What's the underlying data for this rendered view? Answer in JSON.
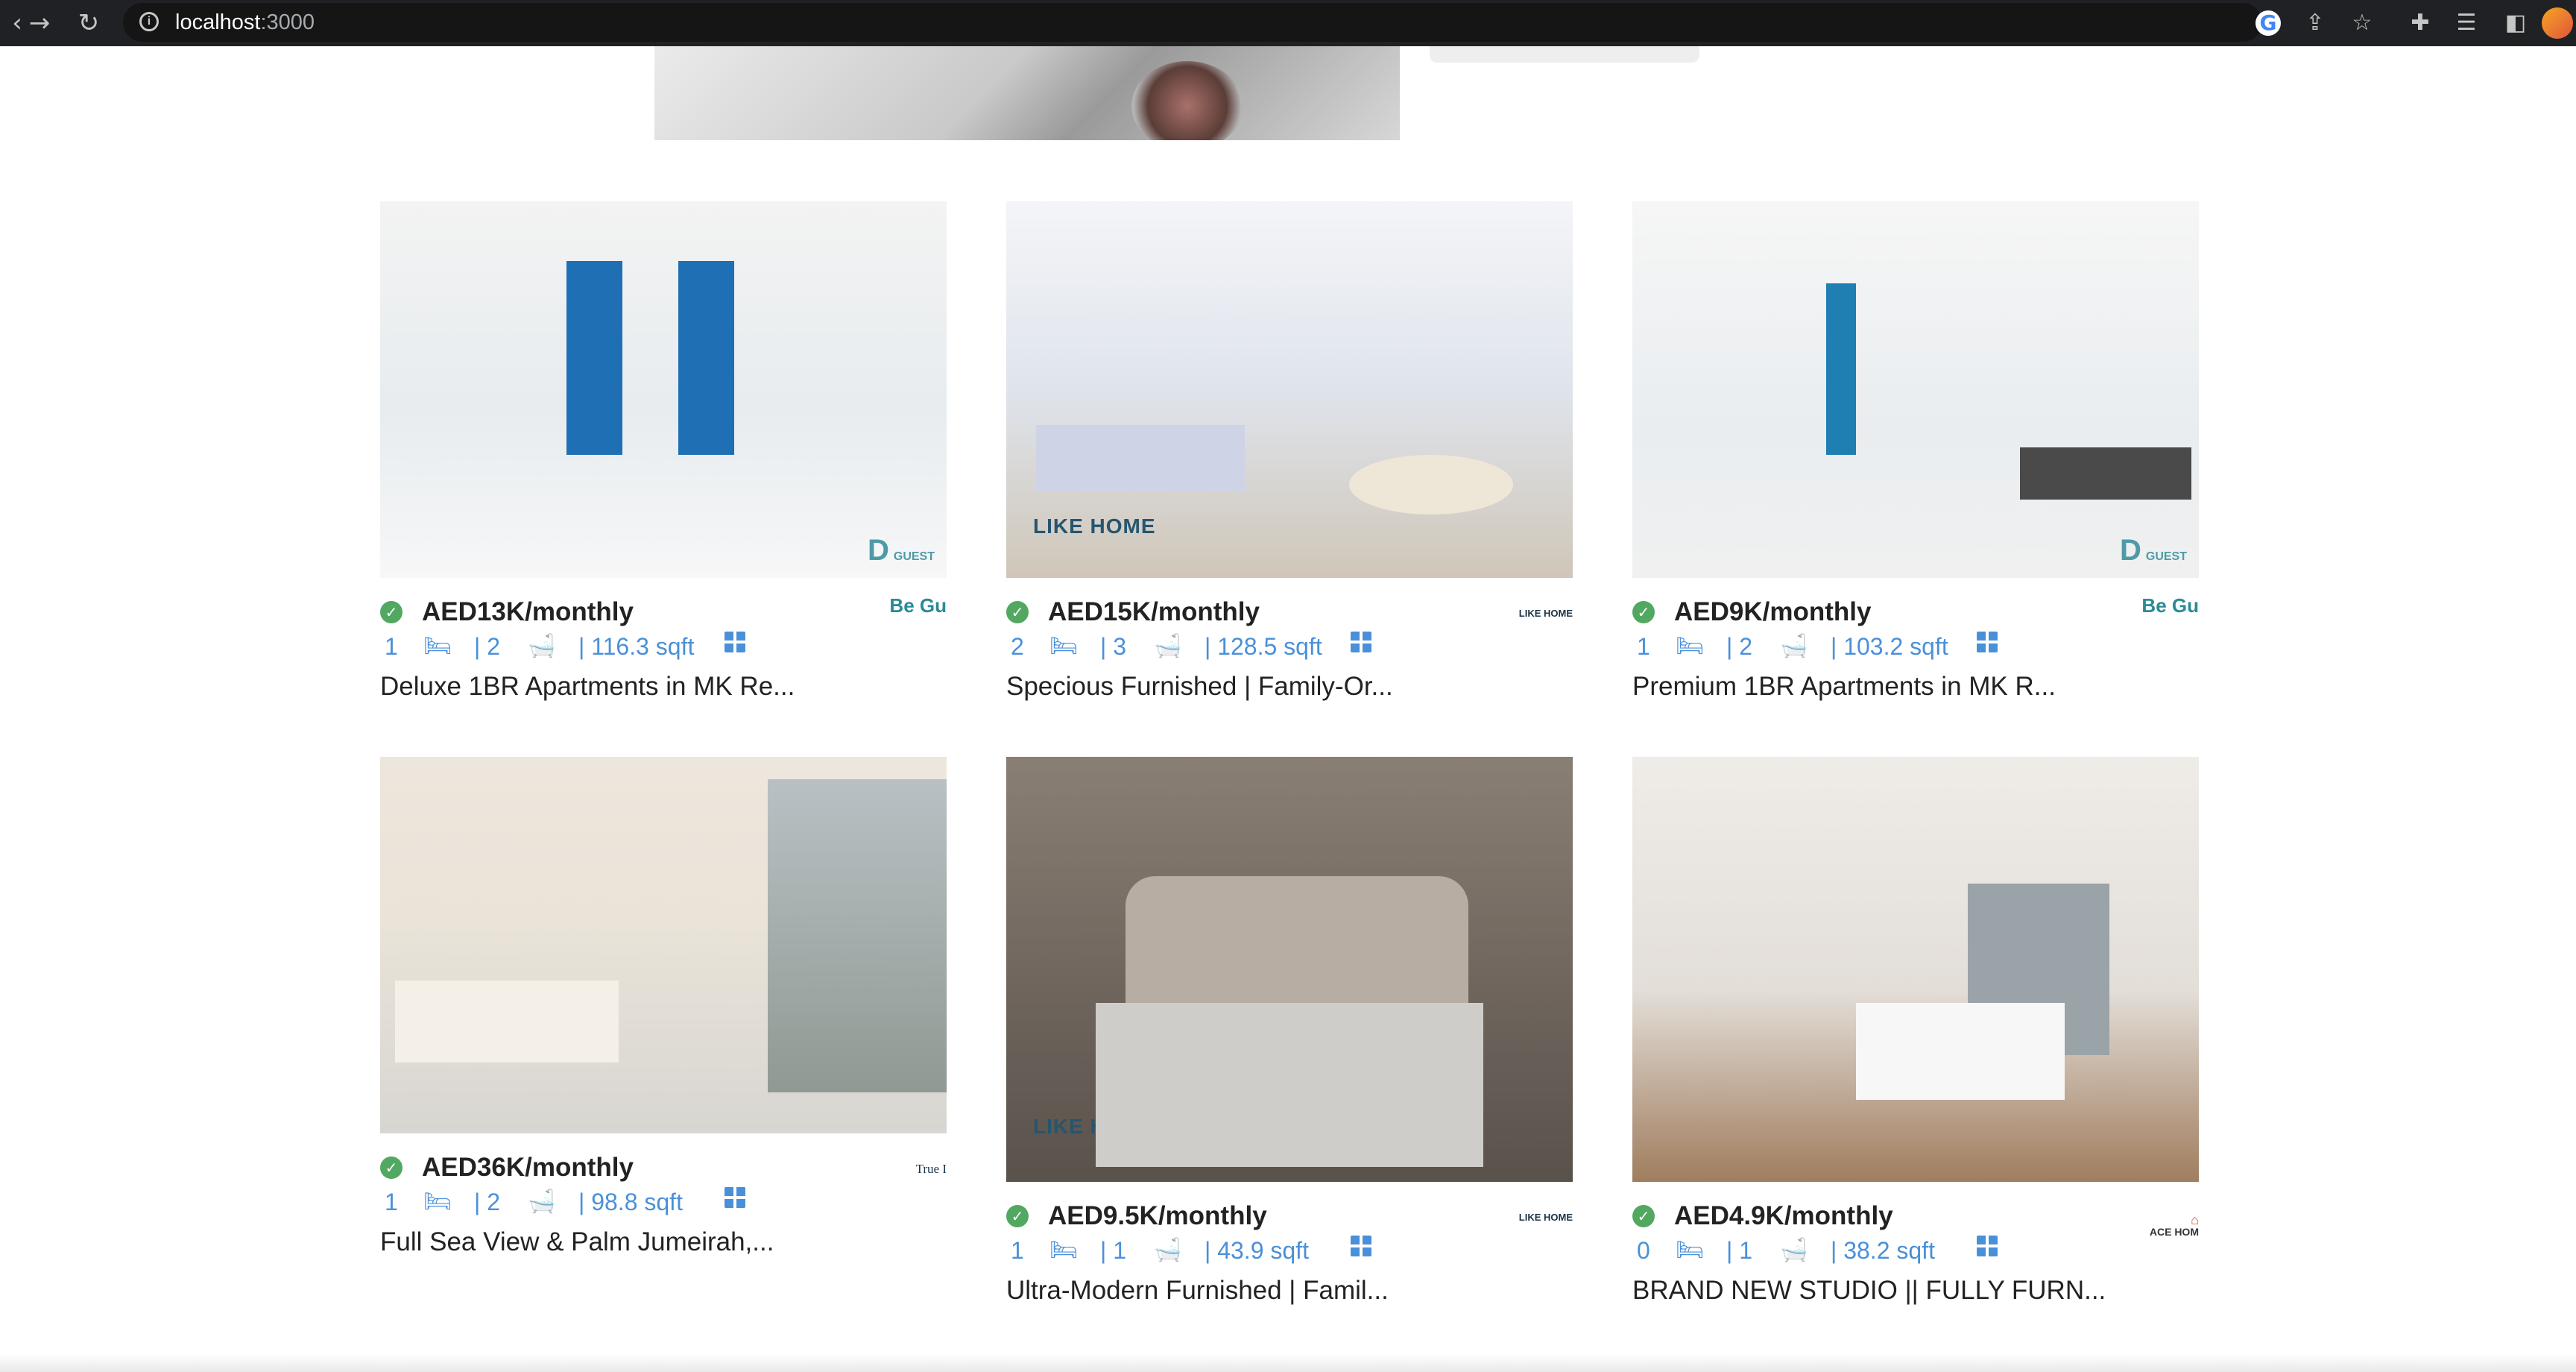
{
  "browser": {
    "url_host": "localhost",
    "url_port": ":3000",
    "toolbar_icons": [
      "google-icon",
      "share-icon",
      "star-icon",
      "extensions-icon",
      "reading-list-icon",
      "side-panel-icon",
      "profile-avatar"
    ]
  },
  "colors": {
    "accent_blue": "#4a90d9",
    "verified_green": "#52a860",
    "text_dark": "#222222"
  },
  "listings": [
    {
      "price": "AED13K/monthly",
      "beds": "1",
      "baths": "| 2",
      "area": "| 116.3 sqft",
      "title": "Deluxe 1BR Apartments in MK Re...",
      "agency_logo": "Be\nGu"
    },
    {
      "price": "AED15K/monthly",
      "beds": "2",
      "baths": "| 3",
      "area": "| 128.5 sqft",
      "title": "Specious Furnished | Family-Or...",
      "agency_logo": "LIKE HOME",
      "watermark": "LIKE HOME"
    },
    {
      "price": "AED9K/monthly",
      "beds": "1",
      "baths": "| 2",
      "area": "| 103.2 sqft",
      "title": "Premium 1BR Apartments in MK R...",
      "agency_logo": "Be\nGu"
    },
    {
      "price": "AED36K/monthly",
      "beds": "1",
      "baths": "| 2",
      "area": "| 98.8 sqft",
      "title": "Full Sea View & Palm Jumeirah,...",
      "agency_logo": "True I"
    },
    {
      "price": "AED9.5K/monthly",
      "beds": "1",
      "baths": "| 1",
      "area": "| 43.9 sqft",
      "title": "Ultra-Modern Furnished | Famil...",
      "agency_logo": "LIKE HOME",
      "watermark": "LIKE HOME"
    },
    {
      "price": "AED4.9K/monthly",
      "beds": "0",
      "baths": "| 1",
      "area": "| 38.2 sqft",
      "title": "BRAND NEW STUDIO || FULLY FURN...",
      "agency_logo": "ACE HOM"
    }
  ]
}
